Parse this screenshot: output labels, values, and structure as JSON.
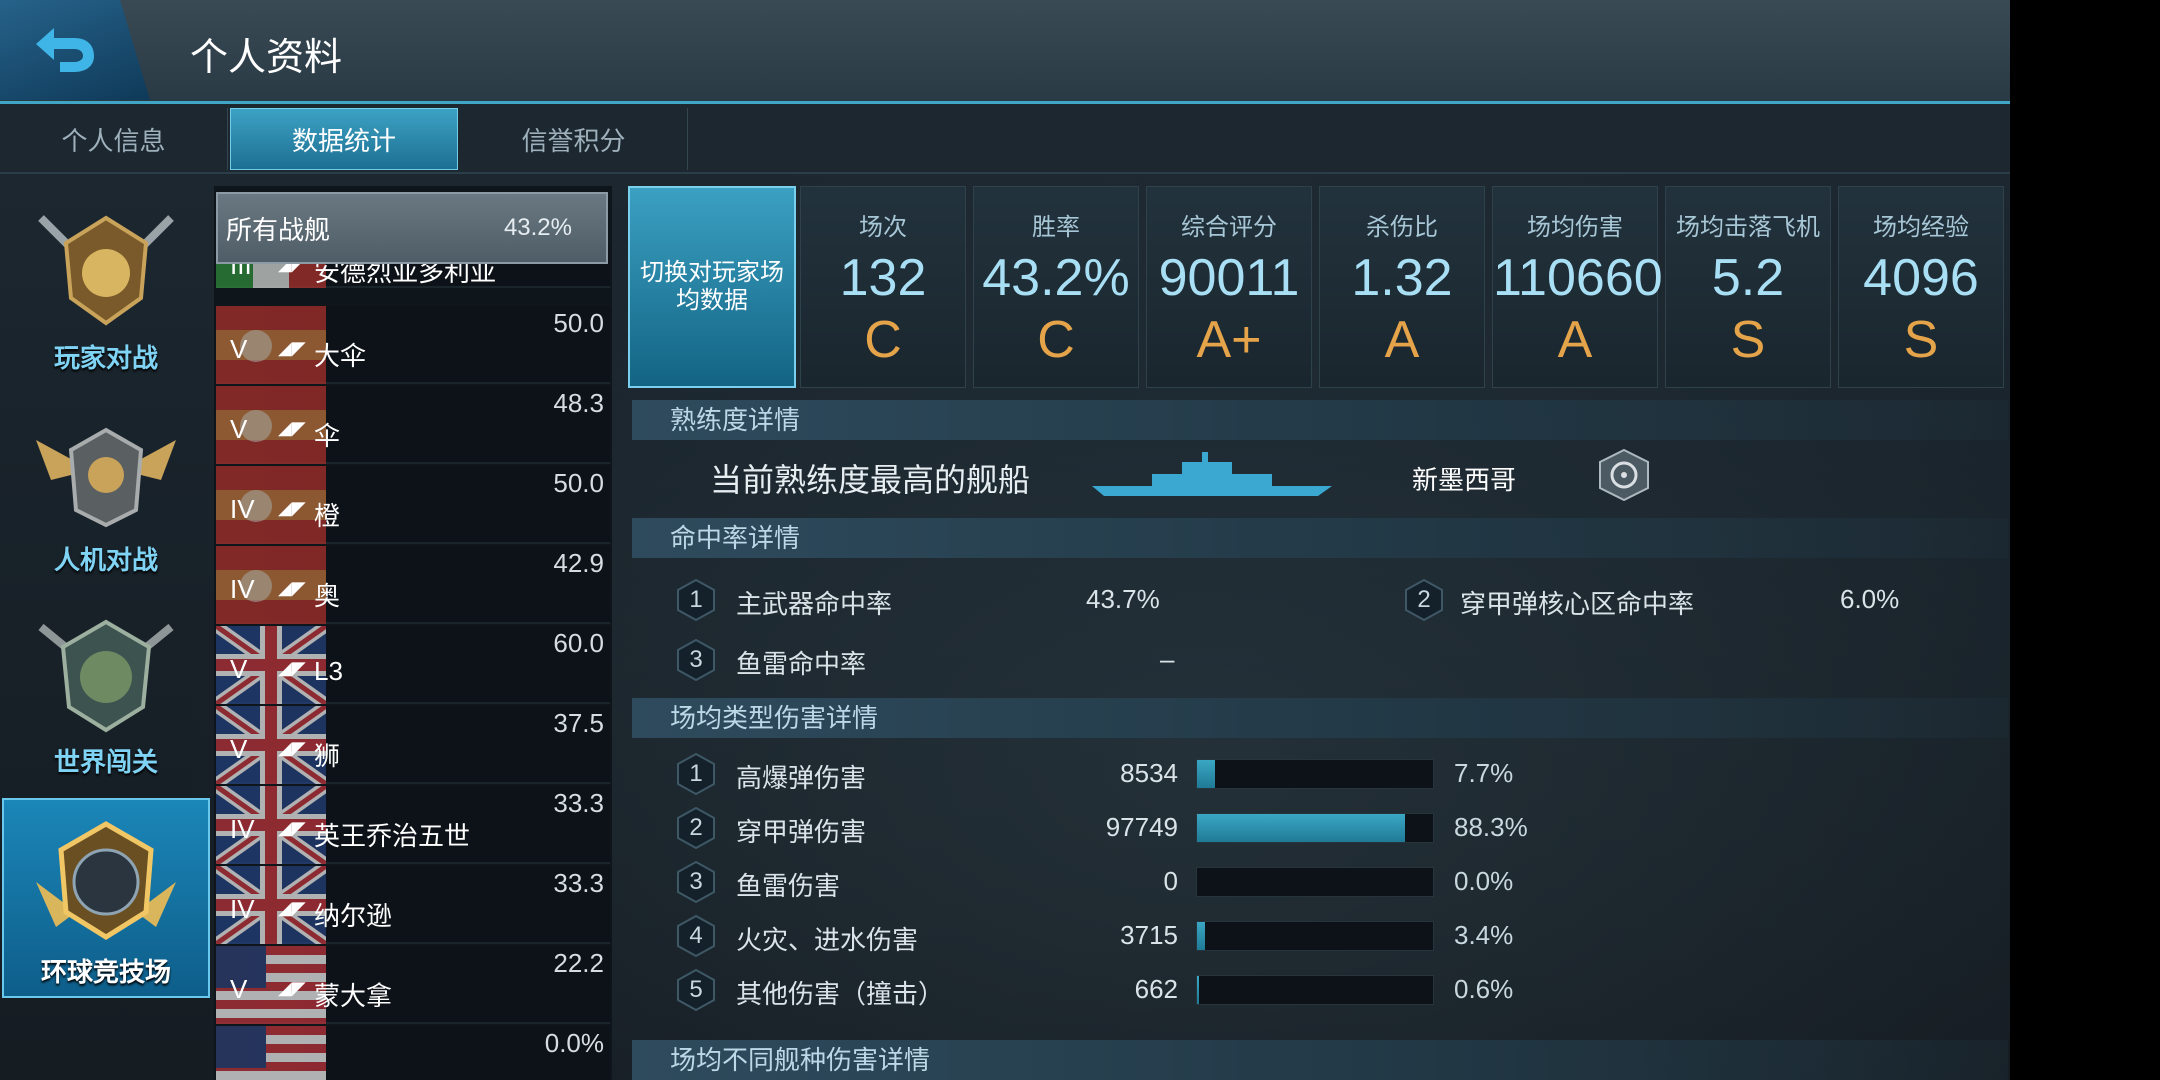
{
  "header": {
    "title": "个人资料",
    "back_icon": "back-arrow-icon"
  },
  "tabs": [
    {
      "label": "个人信息",
      "active": false
    },
    {
      "label": "数据统计",
      "active": true
    },
    {
      "label": "信誉积分",
      "active": false
    }
  ],
  "modes": [
    {
      "label": "玩家对战",
      "active": false
    },
    {
      "label": "人机对战",
      "active": false
    },
    {
      "label": "世界闯关",
      "active": false
    },
    {
      "label": "环球竞技场",
      "active": true
    }
  ],
  "ship_list": {
    "all": {
      "name": "所有战舰",
      "rate": "43.2%"
    },
    "partial_top_name": "安德烈亚多利亚",
    "partial_top_tier": "III",
    "rows": [
      {
        "tier": "V",
        "name": "大伞",
        "rate": "50.0",
        "flag": "spain"
      },
      {
        "tier": "V",
        "name": "伞",
        "rate": "48.3",
        "flag": "spain"
      },
      {
        "tier": "IV",
        "name": "橙",
        "rate": "50.0",
        "flag": "spain"
      },
      {
        "tier": "IV",
        "name": "奥",
        "rate": "42.9",
        "flag": "spain"
      },
      {
        "tier": "V",
        "name": "L3",
        "rate": "60.0",
        "flag": "uk"
      },
      {
        "tier": "V",
        "name": "狮",
        "rate": "37.5",
        "flag": "uk"
      },
      {
        "tier": "IV",
        "name": "英王乔治五世",
        "rate": "33.3",
        "flag": "uk"
      },
      {
        "tier": "IV",
        "name": "纳尔逊",
        "rate": "33.3",
        "flag": "uk"
      },
      {
        "tier": "V",
        "name": "蒙大拿",
        "rate": "22.2",
        "flag": "usa"
      },
      {
        "tier": "",
        "name": "",
        "rate": "0.0%",
        "flag": "usa"
      }
    ]
  },
  "stats": {
    "toggle_label": "切换对玩家场均数据",
    "cards": [
      {
        "label": "场次",
        "value": "132",
        "grade": "C"
      },
      {
        "label": "胜率",
        "value": "43.2%",
        "grade": "C"
      },
      {
        "label": "综合评分",
        "value": "90011",
        "grade": "A+"
      },
      {
        "label": "杀伤比",
        "value": "1.32",
        "grade": "A"
      },
      {
        "label": "场均伤害",
        "value": "110660",
        "grade": "A"
      },
      {
        "label": "场均击落飞机",
        "value": "5.2",
        "grade": "S"
      },
      {
        "label": "场均经验",
        "value": "4096",
        "grade": "S"
      }
    ]
  },
  "proficiency": {
    "title": "熟练度详情",
    "label": "当前熟练度最高的舰船",
    "ship_name": "新墨西哥"
  },
  "accuracy": {
    "title": "命中率详情",
    "items": [
      {
        "num": "1",
        "label": "主武器命中率",
        "value": "43.7%"
      },
      {
        "num": "2",
        "label": "穿甲弹核心区命中率",
        "value": "6.0%"
      },
      {
        "num": "3",
        "label": "鱼雷命中率",
        "value": "–"
      }
    ]
  },
  "damage": {
    "title": "场均类型伤害详情",
    "items": [
      {
        "num": "1",
        "label": "高爆弹伤害",
        "value": "8534",
        "pct": "7.7%",
        "fraction": 0.077
      },
      {
        "num": "2",
        "label": "穿甲弹伤害",
        "value": "97749",
        "pct": "88.3%",
        "fraction": 0.883
      },
      {
        "num": "3",
        "label": "鱼雷伤害",
        "value": "0",
        "pct": "0.0%",
        "fraction": 0.0
      },
      {
        "num": "4",
        "label": "火灾、进水伤害",
        "value": "3715",
        "pct": "3.4%",
        "fraction": 0.034
      },
      {
        "num": "5",
        "label": "其他伤害（撞击）",
        "value": "662",
        "pct": "0.6%",
        "fraction": 0.006
      }
    ]
  },
  "shiptype_damage": {
    "title": "场均不同舰种伤害详情"
  },
  "colors": {
    "accent": "#3fa6c6",
    "grade": "#e5a44a",
    "value": "#a9dff5"
  }
}
